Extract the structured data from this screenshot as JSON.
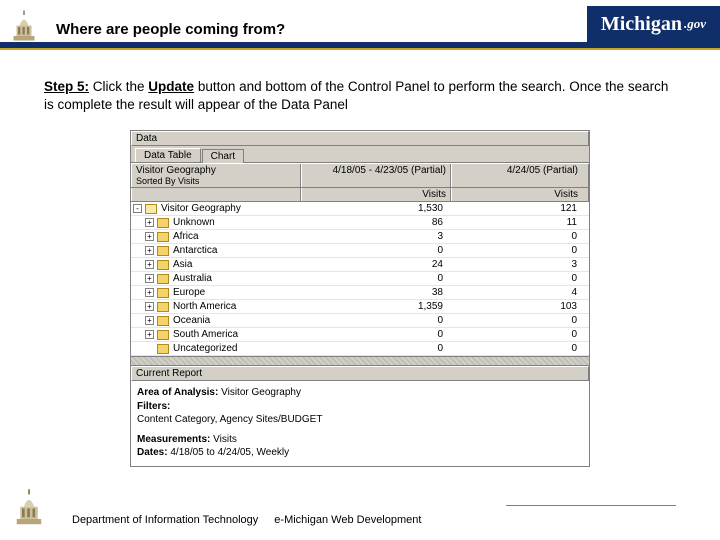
{
  "header": {
    "title": "Where are people coming from?",
    "logo_text": "Michigan",
    "logo_suffix": ".gov"
  },
  "step": {
    "label": "Step 5:",
    "text_before_update": " Click the ",
    "update_word": "Update",
    "text_after": " button and bottom of the Control Panel to perform the search. Once the search is complete the result will appear of the Data Panel"
  },
  "panel": {
    "pane_label": "Data",
    "tabs": {
      "active": "Data Table",
      "inactive": "Chart"
    },
    "header_row": {
      "name": "Visitor Geography",
      "sub": "Sorted By Visits",
      "col_a": "4/18/05 - 4/23/05 (Partial)",
      "col_b": "4/24/05 (Partial)",
      "metric": "Visits"
    },
    "rows": [
      {
        "toggle": "-",
        "folder": "open",
        "name": "Visitor Geography",
        "a": "1,530",
        "b": "121",
        "indent": 0
      },
      {
        "toggle": "+",
        "folder": "closed",
        "name": "Unknown",
        "a": "86",
        "b": "11",
        "indent": 1
      },
      {
        "toggle": "+",
        "folder": "closed",
        "name": "Africa",
        "a": "3",
        "b": "0",
        "indent": 1
      },
      {
        "toggle": "+",
        "folder": "closed",
        "name": "Antarctica",
        "a": "0",
        "b": "0",
        "indent": 1
      },
      {
        "toggle": "+",
        "folder": "closed",
        "name": "Asia",
        "a": "24",
        "b": "3",
        "indent": 1
      },
      {
        "toggle": "+",
        "folder": "closed",
        "name": "Australia",
        "a": "0",
        "b": "0",
        "indent": 1
      },
      {
        "toggle": "+",
        "folder": "closed",
        "name": "Europe",
        "a": "38",
        "b": "4",
        "indent": 1
      },
      {
        "toggle": "+",
        "folder": "closed",
        "name": "North America",
        "a": "1,359",
        "b": "103",
        "indent": 1
      },
      {
        "toggle": "+",
        "folder": "closed",
        "name": "Oceania",
        "a": "0",
        "b": "0",
        "indent": 1
      },
      {
        "toggle": "+",
        "folder": "closed",
        "name": "South America",
        "a": "0",
        "b": "0",
        "indent": 1
      },
      {
        "toggle": "",
        "folder": "closed",
        "name": "Uncategorized",
        "a": "0",
        "b": "0",
        "indent": 1
      }
    ],
    "report": {
      "section": "Current Report",
      "aoa_label": "Area of Analysis:",
      "aoa_value": "Visitor Geography",
      "filters_label": "Filters:",
      "filters_value": "Content Category, Agency Sites/BUDGET",
      "meas_label": "Measurements:",
      "meas_value": "Visits",
      "dates_label": "Dates:",
      "dates_value": "4/18/05 to 4/24/05, Weekly"
    }
  },
  "footer": {
    "dept": "Department of Information Technology",
    "emich": "e-Michigan Web Development"
  }
}
